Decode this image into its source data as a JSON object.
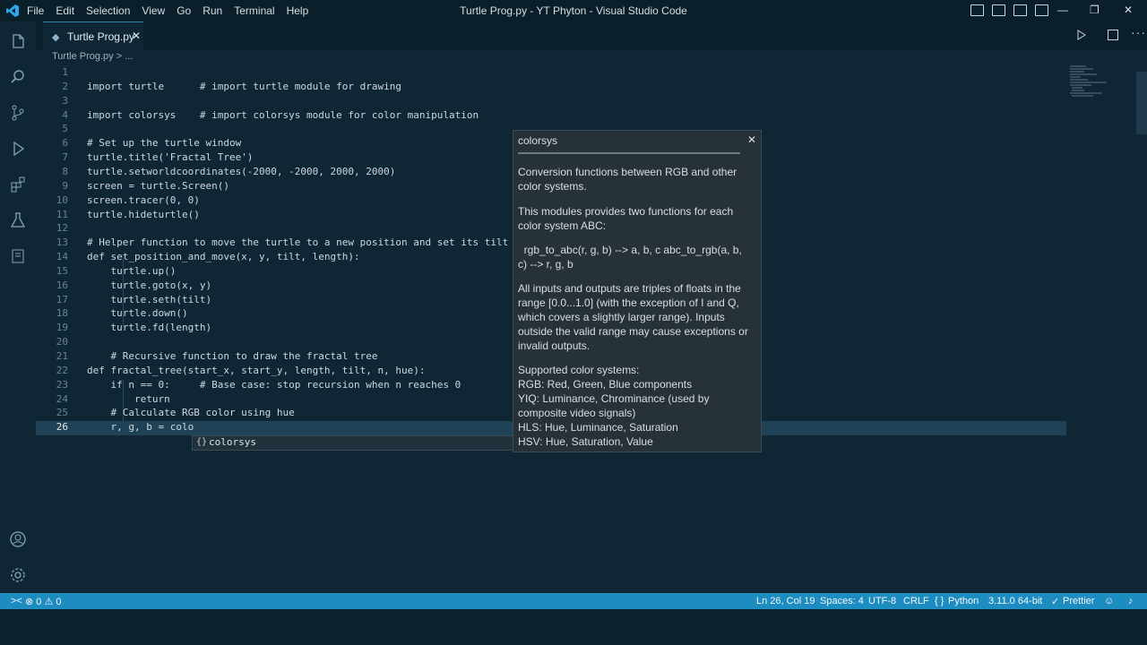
{
  "window": {
    "title": "Turtle Prog.py - YT Phyton - Visual Studio Code",
    "menu": [
      "File",
      "Edit",
      "Selection",
      "View",
      "Go",
      "Run",
      "Terminal",
      "Help"
    ],
    "controls": {
      "minimize": "—",
      "maximize": "❐",
      "close": "✕"
    }
  },
  "activity_bar": {
    "top_icons": [
      "explorer-icon",
      "search-icon",
      "source-control-icon",
      "run-debug-icon",
      "extensions-icon",
      "testing-icon",
      "remote-explorer-icon"
    ],
    "bottom_icons": [
      "account-icon",
      "settings-gear-icon"
    ]
  },
  "tabs": [
    {
      "label": "Turtle Prog.py",
      "icon": "python-file-icon",
      "close": "✕"
    }
  ],
  "breadcrumb": "Turtle Prog.py > ...",
  "editor": {
    "current_line": 26,
    "lines": [
      {
        "n": "1",
        "text": ""
      },
      {
        "n": "2",
        "text": "import turtle      # import turtle module for drawing"
      },
      {
        "n": "3",
        "text": ""
      },
      {
        "n": "4",
        "text": "import colorsys    # import colorsys module for color manipulation"
      },
      {
        "n": "5",
        "text": ""
      },
      {
        "n": "6",
        "text": "# Set up the turtle window"
      },
      {
        "n": "7",
        "text": "turtle.title('Fractal Tree')"
      },
      {
        "n": "8",
        "text": "turtle.setworldcoordinates(-2000, -2000, 2000, 2000)"
      },
      {
        "n": "9",
        "text": "screen = turtle.Screen()"
      },
      {
        "n": "10",
        "text": "screen.tracer(0, 0)"
      },
      {
        "n": "11",
        "text": "turtle.hideturtle()"
      },
      {
        "n": "12",
        "text": ""
      },
      {
        "n": "13",
        "text": "# Helper function to move the turtle to a new position and set its tilt an"
      },
      {
        "n": "14",
        "text": "def set_position_and_move(x, y, tilt, length):"
      },
      {
        "n": "15",
        "text": "    turtle.up()"
      },
      {
        "n": "16",
        "text": "    turtle.goto(x, y)"
      },
      {
        "n": "17",
        "text": "    turtle.seth(tilt)"
      },
      {
        "n": "18",
        "text": "    turtle.down()"
      },
      {
        "n": "19",
        "text": "    turtle.fd(length)"
      },
      {
        "n": "20",
        "text": ""
      },
      {
        "n": "21",
        "text": "    # Recursive function to draw the fractal tree"
      },
      {
        "n": "22",
        "text": "def fractal_tree(start_x, start_y, length, tilt, n, hue):"
      },
      {
        "n": "23",
        "text": "    if n == 0:     # Base case: stop recursion when n reaches 0"
      },
      {
        "n": "24",
        "text": "        return"
      },
      {
        "n": "25",
        "text": "    # Calculate RGB color using hue"
      },
      {
        "n": "26",
        "text": "    r, g, b = colo"
      }
    ]
  },
  "suggest": {
    "icon": "{}",
    "label": "colorsys"
  },
  "doc_popup": {
    "title": "colorsys",
    "close": "✕",
    "p1": "Conversion functions between RGB and other color systems.",
    "p2": "This modules provides two functions for each color system ABC:",
    "p3": "  rgb_to_abc(r, g, b) --> a, b, c abc_to_rgb(a, b, c) --> r, g, b",
    "p4": "All inputs and outputs are triples of floats in the range [0.0...1.0] (with the exception of I and Q, which covers a slightly larger range). Inputs outside the valid range may cause exceptions or invalid outputs.",
    "systems_header": "Supported color systems:",
    "systems": [
      "RGB: Red, Green, Blue components",
      "YIQ: Luminance, Chrominance (used by composite video signals)",
      "HLS: Hue, Luminance, Saturation",
      "HSV: Hue, Saturation, Value"
    ]
  },
  "status": {
    "remote": "⊗ 0 ⚠ 0",
    "position": "Ln 26, Col 19",
    "spaces": "Spaces: 4",
    "encoding": "UTF-8",
    "eol": "CRLF",
    "language": "Python",
    "interpreter": "3.11.0 64-bit",
    "prettier": "Prettier"
  },
  "colors": {
    "accent": "#1d8cc0",
    "editor_bg": "#0f2634",
    "popup_bg": "#263138"
  }
}
